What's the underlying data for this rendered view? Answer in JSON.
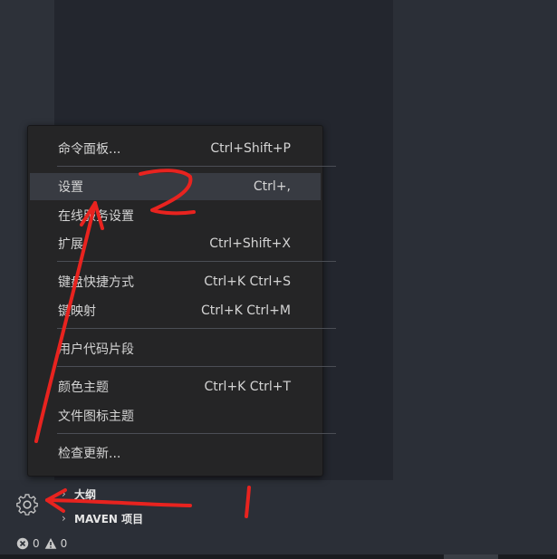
{
  "menu": {
    "items": [
      {
        "label": "命令面板...",
        "shortcut": "Ctrl+Shift+P"
      },
      {
        "label": "设置",
        "shortcut": "Ctrl+,"
      },
      {
        "label": "在线服务设置",
        "shortcut": ""
      },
      {
        "label": "扩展",
        "shortcut": "Ctrl+Shift+X"
      },
      {
        "label": "键盘快捷方式",
        "shortcut": "Ctrl+K Ctrl+S"
      },
      {
        "label": "键映射",
        "shortcut": "Ctrl+K Ctrl+M"
      },
      {
        "label": "用户代码片段",
        "shortcut": ""
      },
      {
        "label": "颜色主题",
        "shortcut": "Ctrl+K Ctrl+T"
      },
      {
        "label": "文件图标主题",
        "shortcut": ""
      },
      {
        "label": "检查更新...",
        "shortcut": ""
      }
    ]
  },
  "panel": {
    "outline_label": "大纲",
    "maven_label": "MAVEN 项目"
  },
  "statusbar": {
    "errors": "0",
    "warnings": "0"
  },
  "annotations": {
    "label_1": "1",
    "label_2": "2",
    "color": "#e8231f"
  }
}
